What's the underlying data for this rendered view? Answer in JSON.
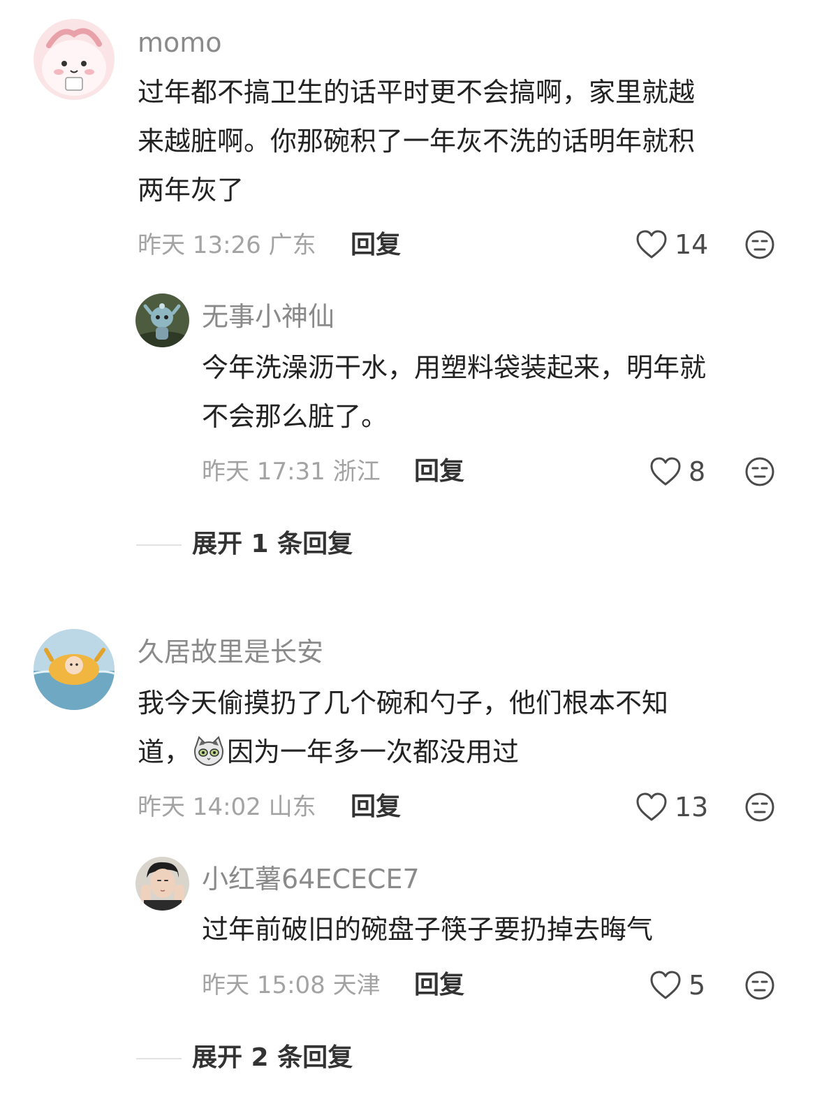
{
  "comments": [
    {
      "username": "momo",
      "lines": [
        "过年都不搞卫生的话平时更不会搞啊，家里就越",
        "来越脏啊。你那碗积了一年灰不洗的话明年就积",
        "两年灰了"
      ],
      "time_location": "昨天 13:26 广东",
      "reply_label": "回复",
      "likes": "14",
      "replies": [
        {
          "username": "无事小神仙",
          "lines": [
            "今年洗澡沥干水，用塑料袋装起来，明年就",
            "不会那么脏了。"
          ],
          "time_location": "昨天 17:31 浙江",
          "reply_label": "回复",
          "likes": "8"
        }
      ],
      "expand_label": "展开 1 条回复"
    },
    {
      "username": "久居故里是长安",
      "lines": [
        "我今天偷摸扔了几个碗和勺子，他们根本不知"
      ],
      "line2_prefix": "道，",
      "line2_suffix": "因为一年多一次都没用过",
      "inline_emoji": "cat-face-emoji",
      "time_location": "昨天 14:02 山东",
      "reply_label": "回复",
      "likes": "13",
      "replies": [
        {
          "username": "小红薯64ECECE7",
          "lines": [
            "过年前破旧的碗盘子筷子要扔掉去晦气"
          ],
          "time_location": "昨天 15:08 天津",
          "reply_label": "回复",
          "likes": "5"
        }
      ],
      "expand_label": "展开 2 条回复"
    }
  ],
  "icons": {
    "like": "heart-outline-icon",
    "dislike": "neutral-face-icon"
  },
  "colors": {
    "username": "#8a8a8a",
    "body": "#222222",
    "meta": "#a3a3a3",
    "action": "#333333"
  }
}
